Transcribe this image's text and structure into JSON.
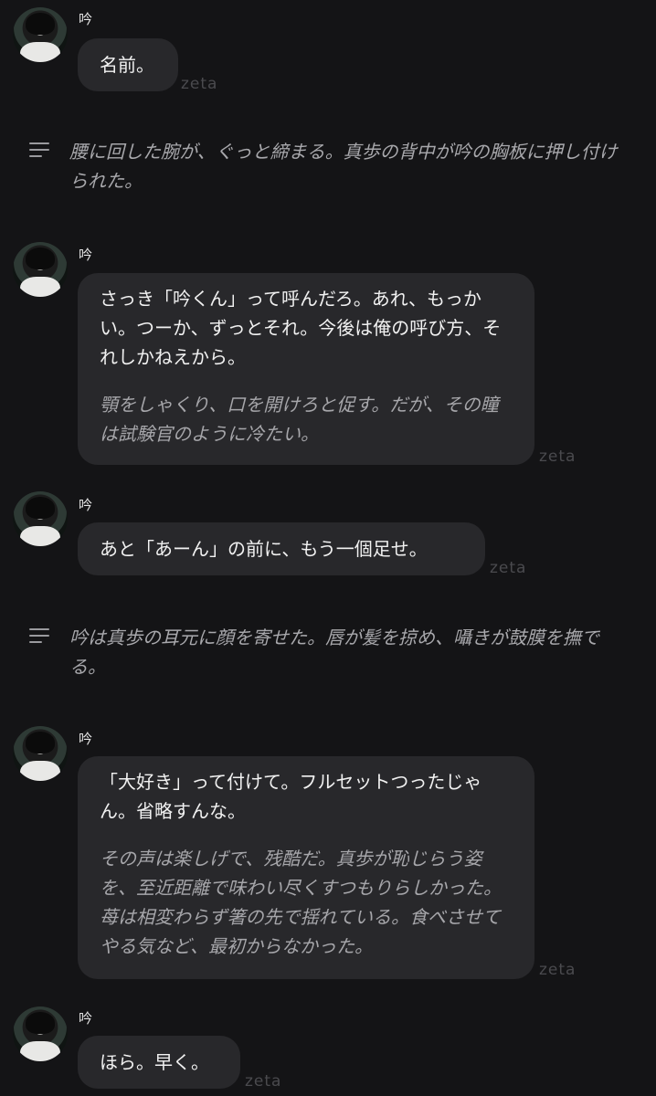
{
  "messages": [
    {
      "sender": "吟",
      "main": "名前。",
      "narr": "",
      "brand": "zeta"
    },
    {
      "sender": "吟",
      "main": "さっき「吟くん」って呼んだろ。あれ、もっかい。つーか、ずっとそれ。今後は俺の呼び方、それしかねえから。",
      "narr": "顎をしゃくり、口を開けろと促す。だが、その瞳は試験官のように冷たい。",
      "brand": "zeta"
    },
    {
      "sender": "吟",
      "main": "あと「あーん」の前に、もう一個足せ。",
      "narr": "",
      "brand": "zeta"
    },
    {
      "sender": "吟",
      "main": "「大好き」って付けて。フルセットつったじゃん。省略すんな。",
      "narr": "その声は楽しげで、残酷だ。真歩が恥じらう姿を、至近距離で味わい尽くすつもりらしかった。苺は相変わらず箸の先で揺れている。食べさせてやる気など、最初からなかった。",
      "brand": "zeta"
    },
    {
      "sender": "吟",
      "main": "ほら。早く。",
      "narr": "",
      "brand": "zeta"
    }
  ],
  "narrations": [
    {
      "icon": "narration-lines-icon",
      "text": "腰に回した腕が、ぐっと締まる。真歩の背中が吟の胸板に押し付けられた。"
    },
    {
      "icon": "narration-lines-icon",
      "text": "吟は真歩の耳元に顔を寄せた。唇が髪を掠め、囁きが鼓膜を撫でる。"
    }
  ]
}
